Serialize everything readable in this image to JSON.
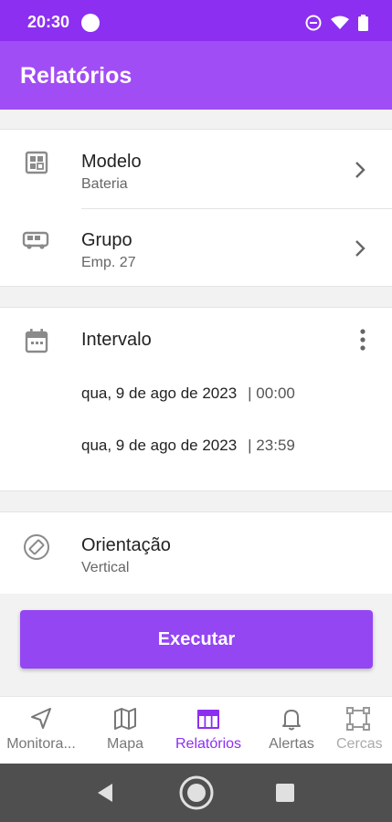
{
  "status_bar": {
    "time": "20:30"
  },
  "app_bar": {
    "title": "Relatórios"
  },
  "report": {
    "model": {
      "title": "Modelo",
      "value": "Bateria"
    },
    "group": {
      "title": "Grupo",
      "value": "Emp. 27"
    },
    "interval": {
      "title": "Intervalo",
      "start": {
        "date": "qua, 9 de ago de 2023",
        "time": "| 00:00"
      },
      "end": {
        "date": "qua, 9 de ago de 2023",
        "time": "| 23:59"
      }
    },
    "orientation": {
      "title": "Orientação",
      "value": "Vertical"
    },
    "execute_label": "Executar"
  },
  "bottom_nav": {
    "items": [
      {
        "label": "Monitora...",
        "icon": "navigation-arrow-icon"
      },
      {
        "label": "Mapa",
        "icon": "map-icon"
      },
      {
        "label": "Relatórios",
        "icon": "table-icon",
        "active": true
      },
      {
        "label": "Alertas",
        "icon": "bell-icon"
      },
      {
        "label": "Cercas",
        "icon": "fence-polygon-icon"
      }
    ]
  },
  "colors": {
    "primary": "#a14df5",
    "status_bar": "#8c2ff0",
    "button": "#9446f3",
    "active_nav": "#8c2ff0"
  }
}
